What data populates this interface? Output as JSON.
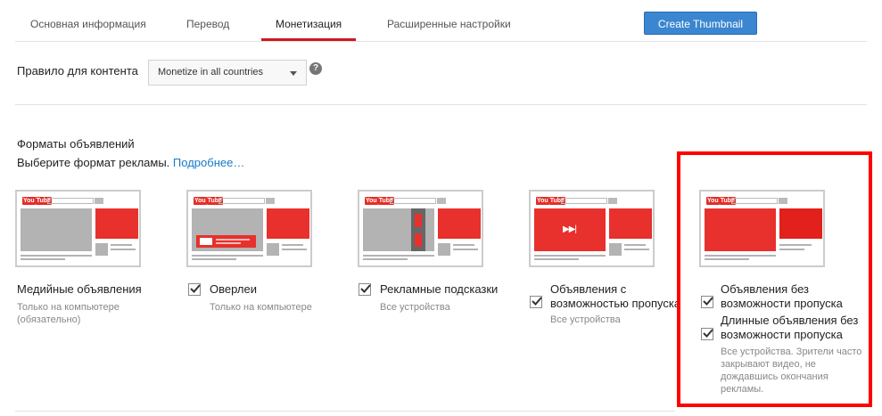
{
  "tabs": [
    "Основная информация",
    "Перевод",
    "Монетизация",
    "Расширенные настройки"
  ],
  "create_thumbnail_label": "Create Thumbnail",
  "content_rule": {
    "label": "Правило для контента",
    "selected": "Monetize in all countries",
    "help_glyph": "?"
  },
  "formats": {
    "title": "Форматы объявлений",
    "subtitle": "Выберите формат рекламы.",
    "link": "Подробнее…"
  },
  "thumb_logo": "You",
  "thumb_logo_tube": "Tube",
  "skip_glyph": "▶▶|",
  "ads": [
    {
      "label": "Медийные объявления",
      "note": "Только на компьютере (обязательно)",
      "checkbox": false
    },
    {
      "label": "Оверлеи",
      "note": "Только на компьютере",
      "checkbox": true,
      "checked": true
    },
    {
      "label": "Рекламные подсказки",
      "note": "Все устройства",
      "checkbox": true,
      "checked": true
    },
    {
      "label": "Объявления с возможностью пропуска",
      "note": "Все устройства",
      "checkbox": true,
      "checked": true
    },
    {
      "label": "Объявления без возможности пропуска",
      "checkbox": true,
      "checked": true
    },
    {
      "label": "Длинные объявления без возможности пропуска",
      "checkbox": true,
      "checked": true,
      "note": "Все устройства. Зрители часто закрывают видео, не дождавшись окончания рекламы."
    }
  ],
  "colors": {
    "accent_red": "#cc181e",
    "button_blue": "#3b86d0",
    "highlight_box": "#ff0000",
    "link_blue": "#167ac6"
  }
}
